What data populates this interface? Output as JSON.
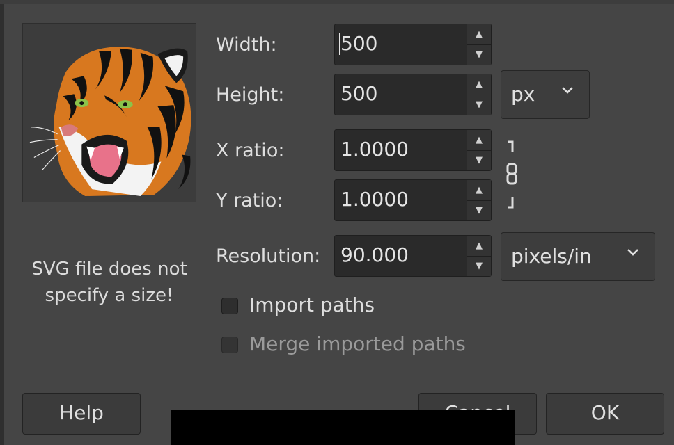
{
  "preview": {
    "icon": "tiger-head-thumbnail"
  },
  "size_note": {
    "line1": "SVG file does not",
    "line2": "specify a size!"
  },
  "fields": {
    "width": {
      "label": "Width:",
      "value": "500"
    },
    "height": {
      "label": "Height:",
      "value": "500"
    },
    "x_ratio": {
      "label": "X ratio:",
      "value": "1.0000"
    },
    "y_ratio": {
      "label": "Y ratio:",
      "value": "1.0000"
    },
    "resolution": {
      "label": "Resolution:",
      "value": "90.000"
    }
  },
  "units": {
    "size_unit": "px",
    "resolution_unit": "pixels/in"
  },
  "checkboxes": {
    "import_paths": {
      "label": "Import paths",
      "checked": false,
      "enabled": true
    },
    "merge_paths": {
      "label": "Merge imported paths",
      "checked": false,
      "enabled": false
    }
  },
  "buttons": {
    "help": "Help",
    "cancel": "Cancel",
    "ok": "OK"
  },
  "icons": {
    "chain": "chain-link-icon",
    "chevron": "chevron-down-icon",
    "spin_up": "arrow-up-icon",
    "spin_down": "arrow-down-icon"
  },
  "colors": {
    "background": "#454545",
    "field_bg": "#2a2a2a",
    "disabled_text": "#9a9a9a"
  }
}
